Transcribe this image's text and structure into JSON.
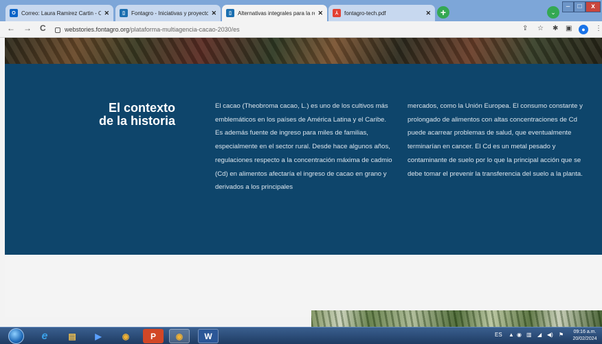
{
  "browser": {
    "tabs": [
      {
        "icon": "outlook-icon",
        "title": "Correo: Laura Ramirez Cartin - O",
        "close": "✕",
        "color": "#0a64c8"
      },
      {
        "icon": "webstories-icon",
        "title": "Fontagro - Iniciativas y proyectos",
        "close": "✕",
        "color": "#1b6fb0"
      },
      {
        "icon": "webstories-icon",
        "title": "Alternativas integrales para la re",
        "close": "✕",
        "color": "#1b6fb0"
      },
      {
        "icon": "pdf-icon",
        "title": "fontagro-tech.pdf",
        "close": "✕",
        "color": "#e34133"
      }
    ],
    "new_tab": "+",
    "tab_search": "⌄",
    "window": {
      "minimize": "–",
      "maximize": "□",
      "close": "x"
    },
    "nav": {
      "back": "←",
      "forward": "→",
      "reload": "C"
    },
    "url_host": "webstories.fontagro.org",
    "url_path": "/plataforma-multiagencia-cacao-2030/es",
    "actions": {
      "share": "⇪",
      "bookmark": "☆",
      "extensions": "✱",
      "sidepanel": "▣",
      "profile": "●",
      "menu": "⋮"
    }
  },
  "page": {
    "heading_line1": "El contexto",
    "heading_line2": "de la historia",
    "col1": "El cacao (Theobroma cacao, L.) es uno de los cultivos más emblemáticos en los países de América Latina y el Caribe. Es además fuente de ingreso para miles de familias, especialmente en el sector rural. Desde hace algunos años, regulaciones respecto a la concentración máxima de cadmio (Cd) en alimentos afectaría el ingreso de cacao en grano y derivados a los principales",
    "col2": "mercados, como la Unión Europea. El consumo constante y prolongado de alimentos con altas concentraciones de Cd puede acarrear problemas de salud, que eventualmente terminarían en cancer. El Cd es un metal pesado y contaminante de suelo por lo que la principal acción que se debe tomar el prevenir la transferencia del suelo a la planta."
  },
  "taskbar": {
    "apps": [
      {
        "name": "ie-icon",
        "glyph": "e",
        "color": "#3aa0e8"
      },
      {
        "name": "explorer-icon",
        "glyph": "▤",
        "color": "#f2c14e"
      },
      {
        "name": "media-icon",
        "glyph": "▶",
        "color": "#2d6fd1"
      },
      {
        "name": "chrome-icon",
        "glyph": "◉",
        "color": "#e84b3a"
      },
      {
        "name": "powerpoint-icon",
        "glyph": "P",
        "color": "#d24726"
      },
      {
        "name": "chrome-active-icon",
        "glyph": "◉",
        "color": "#e84b3a"
      },
      {
        "name": "word-icon",
        "glyph": "W",
        "color": "#2b5797"
      }
    ],
    "lang": "ES",
    "time": "09:16 a.m.",
    "date": "20/02/2024"
  }
}
